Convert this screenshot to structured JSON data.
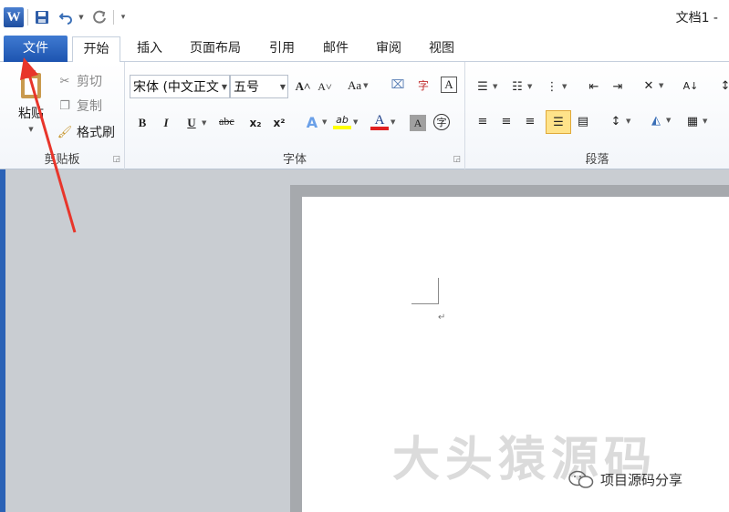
{
  "window": {
    "title": "文档1 -"
  },
  "tabs": [
    "文件",
    "开始",
    "插入",
    "页面布局",
    "引用",
    "邮件",
    "审阅",
    "视图"
  ],
  "clipboard": {
    "paste_label": "粘贴",
    "cut_label": "剪切",
    "copy_label": "复制",
    "format_painter_label": "格式刷",
    "group_label": "剪贴板"
  },
  "font": {
    "font_name": "宋体 (中文正文",
    "font_size": "五号",
    "group_label": "字体",
    "bold": "B",
    "italic": "I",
    "underline": "U",
    "strike": "abc",
    "subscript": "x₂",
    "superscript": "x²",
    "change_case": "Aa",
    "font_color_letter": "A",
    "highlight_label": "ab"
  },
  "paragraph": {
    "group_label": "段落"
  },
  "watermark": {
    "text": "大头猿源码",
    "wechat_caption": "项目源码分享"
  },
  "colors": {
    "file_tab": "#2b5fb4",
    "highlight": "#ffff00",
    "font_color": "#e02020",
    "arrow": "#e8352b"
  }
}
